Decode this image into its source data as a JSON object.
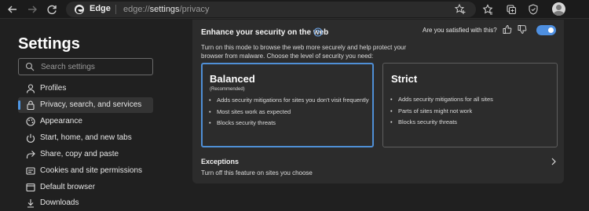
{
  "toolbar": {
    "brand": "Edge",
    "url_prefix": "edge://",
    "url_highlight": "settings",
    "url_suffix": "/privacy"
  },
  "sidebar": {
    "title": "Settings",
    "search_placeholder": "Search settings",
    "items": [
      {
        "label": "Profiles",
        "icon": "person-icon"
      },
      {
        "label": "Privacy, search, and services",
        "icon": "lock-icon",
        "active": true
      },
      {
        "label": "Appearance",
        "icon": "appearance-icon"
      },
      {
        "label": "Start, home, and new tabs",
        "icon": "power-icon"
      },
      {
        "label": "Share, copy and paste",
        "icon": "share-icon"
      },
      {
        "label": "Cookies and site permissions",
        "icon": "cookies-icon"
      },
      {
        "label": "Default browser",
        "icon": "browser-icon"
      },
      {
        "label": "Downloads",
        "icon": "download-icon"
      }
    ]
  },
  "main": {
    "title": "Enhance your security on the web",
    "satisfied": "Are you satisfied with this?",
    "toggle_on": true,
    "description": "Turn on this mode to browse the web more securely and help protect your browser from malware. Choose the level of security you need:",
    "options": [
      {
        "title": "Balanced",
        "subtitle": "(Recommended)",
        "selected": true,
        "bullets": [
          "Adds security mitigations for sites you don't visit frequently",
          "Most sites work as expected",
          "Blocks security threats"
        ]
      },
      {
        "title": "Strict",
        "selected": false,
        "bullets": [
          "Adds security mitigations for all sites",
          "Parts of sites might not work",
          "Blocks security threats"
        ]
      }
    ],
    "exceptions": {
      "title": "Exceptions",
      "description": "Turn off this feature on sites you choose"
    }
  },
  "colors": {
    "accent": "#4e8fe0",
    "background": "#202020",
    "card": "#2c2c2c"
  }
}
